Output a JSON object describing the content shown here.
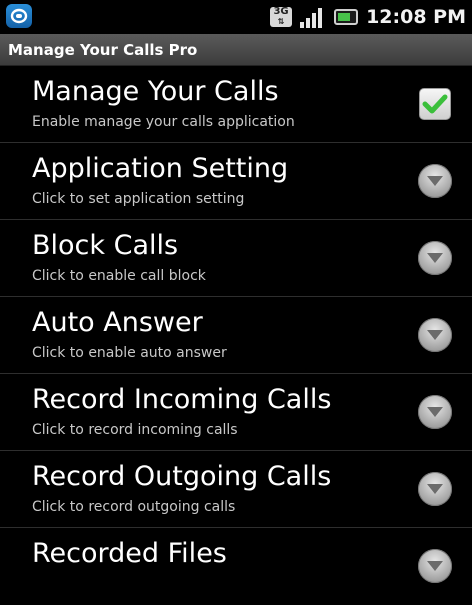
{
  "status_bar": {
    "time": "12:08 PM",
    "network_label": "3G",
    "icons": [
      "app-notification-icon",
      "3g-network-icon",
      "signal-strength-icon",
      "battery-icon"
    ]
  },
  "title_bar": {
    "title": "Manage Your Calls Pro"
  },
  "settings": [
    {
      "title": "Manage Your Calls",
      "subtitle": "Enable manage your calls application",
      "control": "checkbox",
      "checked": true
    },
    {
      "title": "Application Setting",
      "subtitle": "Click to set application setting",
      "control": "arrow"
    },
    {
      "title": "Block Calls",
      "subtitle": "Click to enable call block",
      "control": "arrow"
    },
    {
      "title": "Auto Answer",
      "subtitle": "Click to enable auto answer",
      "control": "arrow"
    },
    {
      "title": "Record Incoming Calls",
      "subtitle": "Click to record incoming calls",
      "control": "arrow"
    },
    {
      "title": "Record Outgoing Calls",
      "subtitle": "Click to record outgoing calls",
      "control": "arrow"
    },
    {
      "title": "Recorded Files",
      "subtitle": "",
      "control": "arrow"
    }
  ],
  "colors": {
    "background": "#000000",
    "title_bar": "#4a4a4a",
    "check_green": "#3bbf3b",
    "divider": "#2e2e2e"
  }
}
